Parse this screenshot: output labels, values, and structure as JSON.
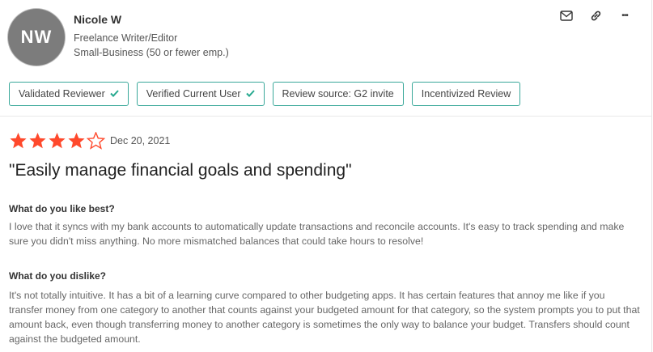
{
  "reviewer": {
    "initials": "NW",
    "name": "Nicole W",
    "role": "Freelance Writer/Editor",
    "company_size": "Small-Business (50 or fewer emp.)"
  },
  "actions": {
    "icons": [
      "mail-icon",
      "link-icon",
      "more-icon"
    ],
    "more_label": "•••"
  },
  "badges": [
    {
      "label": "Validated Reviewer",
      "checked": true
    },
    {
      "label": "Verified Current User",
      "checked": true
    },
    {
      "label": "Review source: G2 invite",
      "checked": false
    },
    {
      "label": "Incentivized Review",
      "checked": false
    }
  ],
  "review": {
    "rating": 4,
    "max_rating": 5,
    "date": "Dec 20, 2021",
    "title": "\"Easily manage financial goals and spending\"",
    "likes_heading": "What do you like best?",
    "likes_text": "I love that it syncs with my bank accounts to automatically update transactions and reconcile accounts. It's easy to track spending and make sure you didn't miss anything. No more mismatched balances that could take hours to resolve!",
    "dislikes_heading": "What do you dislike?",
    "dislikes_text": "It's not totally intuitive. It has a bit of a learning curve compared to other budgeting apps. It has certain features that annoy me like if you transfer money from one category to another that counts against your budgeted amount for that category, so the system prompts you to put that amount back, even though transferring money to another category is sometimes the only way to balance your budget. Transfers should count against the budgeted amount."
  },
  "colors": {
    "star_filled": "#ff492c",
    "star_empty": "#ff492c",
    "badge_border": "#3aa89a",
    "check": "#27a98f"
  }
}
